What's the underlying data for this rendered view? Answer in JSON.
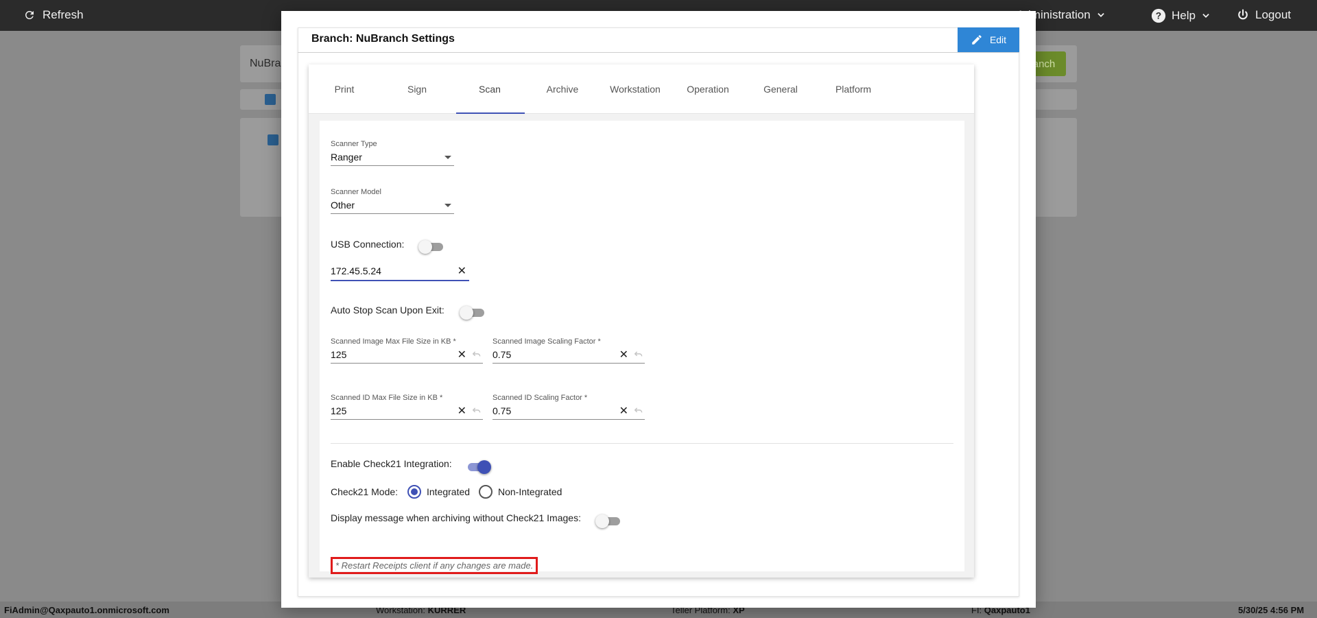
{
  "topbar": {
    "refresh_label": "Refresh",
    "administration_label": "Administration",
    "help_label": "Help",
    "logout_label": "Logout"
  },
  "background": {
    "search_value": "NuBra",
    "add_branch_label": "anch"
  },
  "statusbar": {
    "user": "FiAdmin@Qaxpauto1.onmicrosoft.com",
    "workstation_label": "Workstation:",
    "workstation_value": "KURRER",
    "teller_platform_label": "Teller Platform:",
    "teller_platform_value": "XP",
    "fi_label": "FI:",
    "fi_value": "Qaxpauto1",
    "datetime": "5/30/25 4:56 PM"
  },
  "modal": {
    "title": "Branch: NuBranch Settings",
    "edit_label": "Edit",
    "tabs": [
      {
        "label": "Print"
      },
      {
        "label": "Sign"
      },
      {
        "label": "Scan"
      },
      {
        "label": "Archive"
      },
      {
        "label": "Workstation"
      },
      {
        "label": "Operation"
      },
      {
        "label": "General"
      },
      {
        "label": "Platform"
      }
    ],
    "active_tab": "Scan"
  },
  "scan": {
    "scanner_type_label": "Scanner Type",
    "scanner_type_value": "Ranger",
    "scanner_model_label": "Scanner Model",
    "scanner_model_value": "Other",
    "usb_connection_label": "USB Connection:",
    "usb_connection_on": false,
    "ip_address_value": "172.45.5.24",
    "auto_stop_label": "Auto Stop Scan Upon Exit:",
    "auto_stop_on": false,
    "image_max_size_label": "Scanned Image Max File Size in KB *",
    "image_max_size_value": "125",
    "image_scaling_label": "Scanned Image Scaling Factor *",
    "image_scaling_value": "0.75",
    "id_max_size_label": "Scanned ID Max File Size in KB *",
    "id_max_size_value": "125",
    "id_scaling_label": "Scanned ID Scaling Factor *",
    "id_scaling_value": "0.75",
    "check21_label": "Enable Check21 Integration:",
    "check21_on": true,
    "check21_mode_label": "Check21 Mode:",
    "mode_integrated_label": "Integrated",
    "mode_non_integrated_label": "Non-Integrated",
    "mode_selected": "Integrated",
    "display_message_label": "Display message when archiving without Check21 Images:",
    "display_message_on": false,
    "restart_note": "* Restart Receipts client if any changes are made."
  },
  "colors": {
    "accent": "#3f51b5",
    "edit_button": "#2f86d6",
    "note_border": "#e01b1b",
    "topbar": "#2b2b2b"
  },
  "icons": {
    "clear": "close-icon",
    "undo": "undo-icon",
    "edit": "pencil-icon",
    "refresh": "refresh-icon",
    "help": "help-circle-icon",
    "logout": "power-icon"
  }
}
